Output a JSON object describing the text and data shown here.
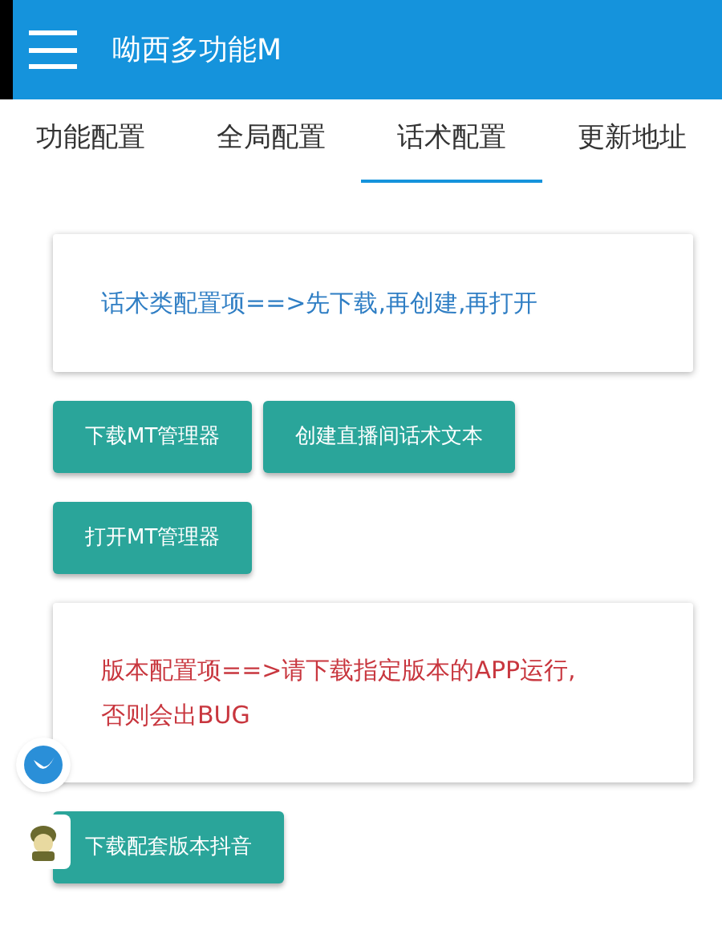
{
  "app_bar": {
    "title": "呦西多功能M"
  },
  "tabs": [
    {
      "label": "功能配置",
      "selected": false
    },
    {
      "label": "全局配置",
      "selected": false
    },
    {
      "label": "话术配置",
      "selected": true
    },
    {
      "label": "更新地址",
      "selected": false
    }
  ],
  "sections": [
    {
      "kind": "info",
      "text": "话术类配置项==>先下载,再创建,再打开",
      "color": "#2f7ec4"
    },
    {
      "kind": "buttons",
      "buttons": [
        "下载MT管理器",
        "创建直播间话术文本"
      ]
    },
    {
      "kind": "buttons",
      "buttons": [
        "打开MT管理器"
      ]
    },
    {
      "kind": "info",
      "text": "版本配置项==>请下载指定版本的APP运行,否则会出BUG",
      "color": "#c8363e"
    },
    {
      "kind": "buttons",
      "buttons": [
        "下载配套版本抖音"
      ]
    }
  ]
}
